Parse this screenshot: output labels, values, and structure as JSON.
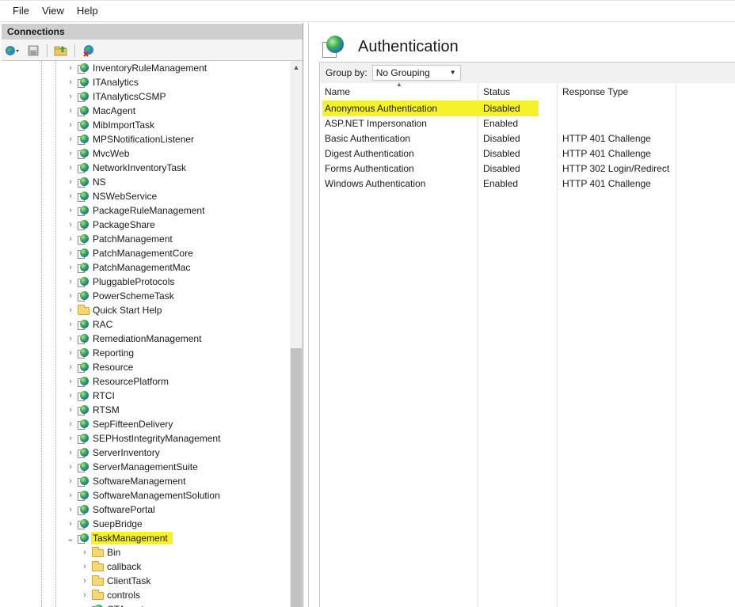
{
  "menubar": {
    "items": [
      "File",
      "View",
      "Help"
    ]
  },
  "connections": {
    "title": "Connections",
    "toolbar_icons": [
      "connect-globe-icon",
      "save-icon",
      "up-folder-icon",
      "delete-connection-icon"
    ]
  },
  "tree": {
    "items": [
      {
        "label": "InventoryRuleManagement",
        "icon": "globe-icon"
      },
      {
        "label": "ITAnalytics",
        "icon": "globe-icon"
      },
      {
        "label": "ITAnalyticsCSMP",
        "icon": "globe-icon"
      },
      {
        "label": "MacAgent",
        "icon": "globe-icon"
      },
      {
        "label": "MibImportTask",
        "icon": "globe-icon"
      },
      {
        "label": "MPSNotificationListener",
        "icon": "globe-icon"
      },
      {
        "label": "MvcWeb",
        "icon": "globe-icon"
      },
      {
        "label": "NetworkInventoryTask",
        "icon": "globe-icon"
      },
      {
        "label": "NS",
        "icon": "globe-icon"
      },
      {
        "label": "NSWebService",
        "icon": "globe-icon"
      },
      {
        "label": "PackageRuleManagement",
        "icon": "globe-icon"
      },
      {
        "label": "PackageShare",
        "icon": "globe-icon"
      },
      {
        "label": "PatchManagement",
        "icon": "globe-icon"
      },
      {
        "label": "PatchManagementCore",
        "icon": "globe-icon"
      },
      {
        "label": "PatchManagementMac",
        "icon": "globe-icon"
      },
      {
        "label": "PluggableProtocols",
        "icon": "globe-icon"
      },
      {
        "label": "PowerSchemeTask",
        "icon": "globe-icon"
      },
      {
        "label": "Quick Start Help",
        "icon": "folder-icon"
      },
      {
        "label": "RAC",
        "icon": "globe-icon"
      },
      {
        "label": "RemediationManagement",
        "icon": "globe-icon"
      },
      {
        "label": "Reporting",
        "icon": "globe-icon"
      },
      {
        "label": "Resource",
        "icon": "globe-icon"
      },
      {
        "label": "ResourcePlatform",
        "icon": "globe-icon"
      },
      {
        "label": "RTCI",
        "icon": "globe-icon"
      },
      {
        "label": "RTSM",
        "icon": "globe-icon"
      },
      {
        "label": "SepFifteenDelivery",
        "icon": "globe-icon"
      },
      {
        "label": "SEPHostIntegrityManagement",
        "icon": "globe-icon"
      },
      {
        "label": "ServerInventory",
        "icon": "globe-icon"
      },
      {
        "label": "ServerManagementSuite",
        "icon": "globe-icon"
      },
      {
        "label": "SoftwareManagement",
        "icon": "globe-icon"
      },
      {
        "label": "SoftwareManagementSolution",
        "icon": "globe-icon"
      },
      {
        "label": "SoftwarePortal",
        "icon": "globe-icon"
      },
      {
        "label": "SuepBridge",
        "icon": "globe-icon"
      },
      {
        "label": "TaskManagement",
        "icon": "globe-icon",
        "expanded": true,
        "selected": true
      },
      {
        "label": "Bin",
        "icon": "folder-icon",
        "child": true
      },
      {
        "label": "callback",
        "icon": "folder-icon",
        "child": true
      },
      {
        "label": "ClientTask",
        "icon": "folder-icon",
        "child": true
      },
      {
        "label": "controls",
        "icon": "folder-icon",
        "child": true
      },
      {
        "label": "CTAgent",
        "icon": "globe-icon",
        "child": true
      }
    ]
  },
  "main": {
    "title": "Authentication",
    "group_by_label": "Group by:",
    "group_by_value": "No Grouping",
    "columns": [
      "Name",
      "Status",
      "Response Type"
    ],
    "rows": [
      {
        "name": "Anonymous Authentication",
        "status": "Disabled",
        "response": "",
        "highlighted": true
      },
      {
        "name": "ASP.NET Impersonation",
        "status": "Enabled",
        "response": ""
      },
      {
        "name": "Basic Authentication",
        "status": "Disabled",
        "response": "HTTP 401 Challenge"
      },
      {
        "name": "Digest Authentication",
        "status": "Disabled",
        "response": "HTTP 401 Challenge"
      },
      {
        "name": "Forms Authentication",
        "status": "Disabled",
        "response": "HTTP 302 Login/Redirect"
      },
      {
        "name": "Windows Authentication",
        "status": "Enabled",
        "response": "HTTP 401 Challenge"
      }
    ]
  },
  "colors": {
    "highlight": "#f5f22a",
    "header_bg": "#cfcfcf",
    "groupbar_bg": "#f0f0f0"
  }
}
